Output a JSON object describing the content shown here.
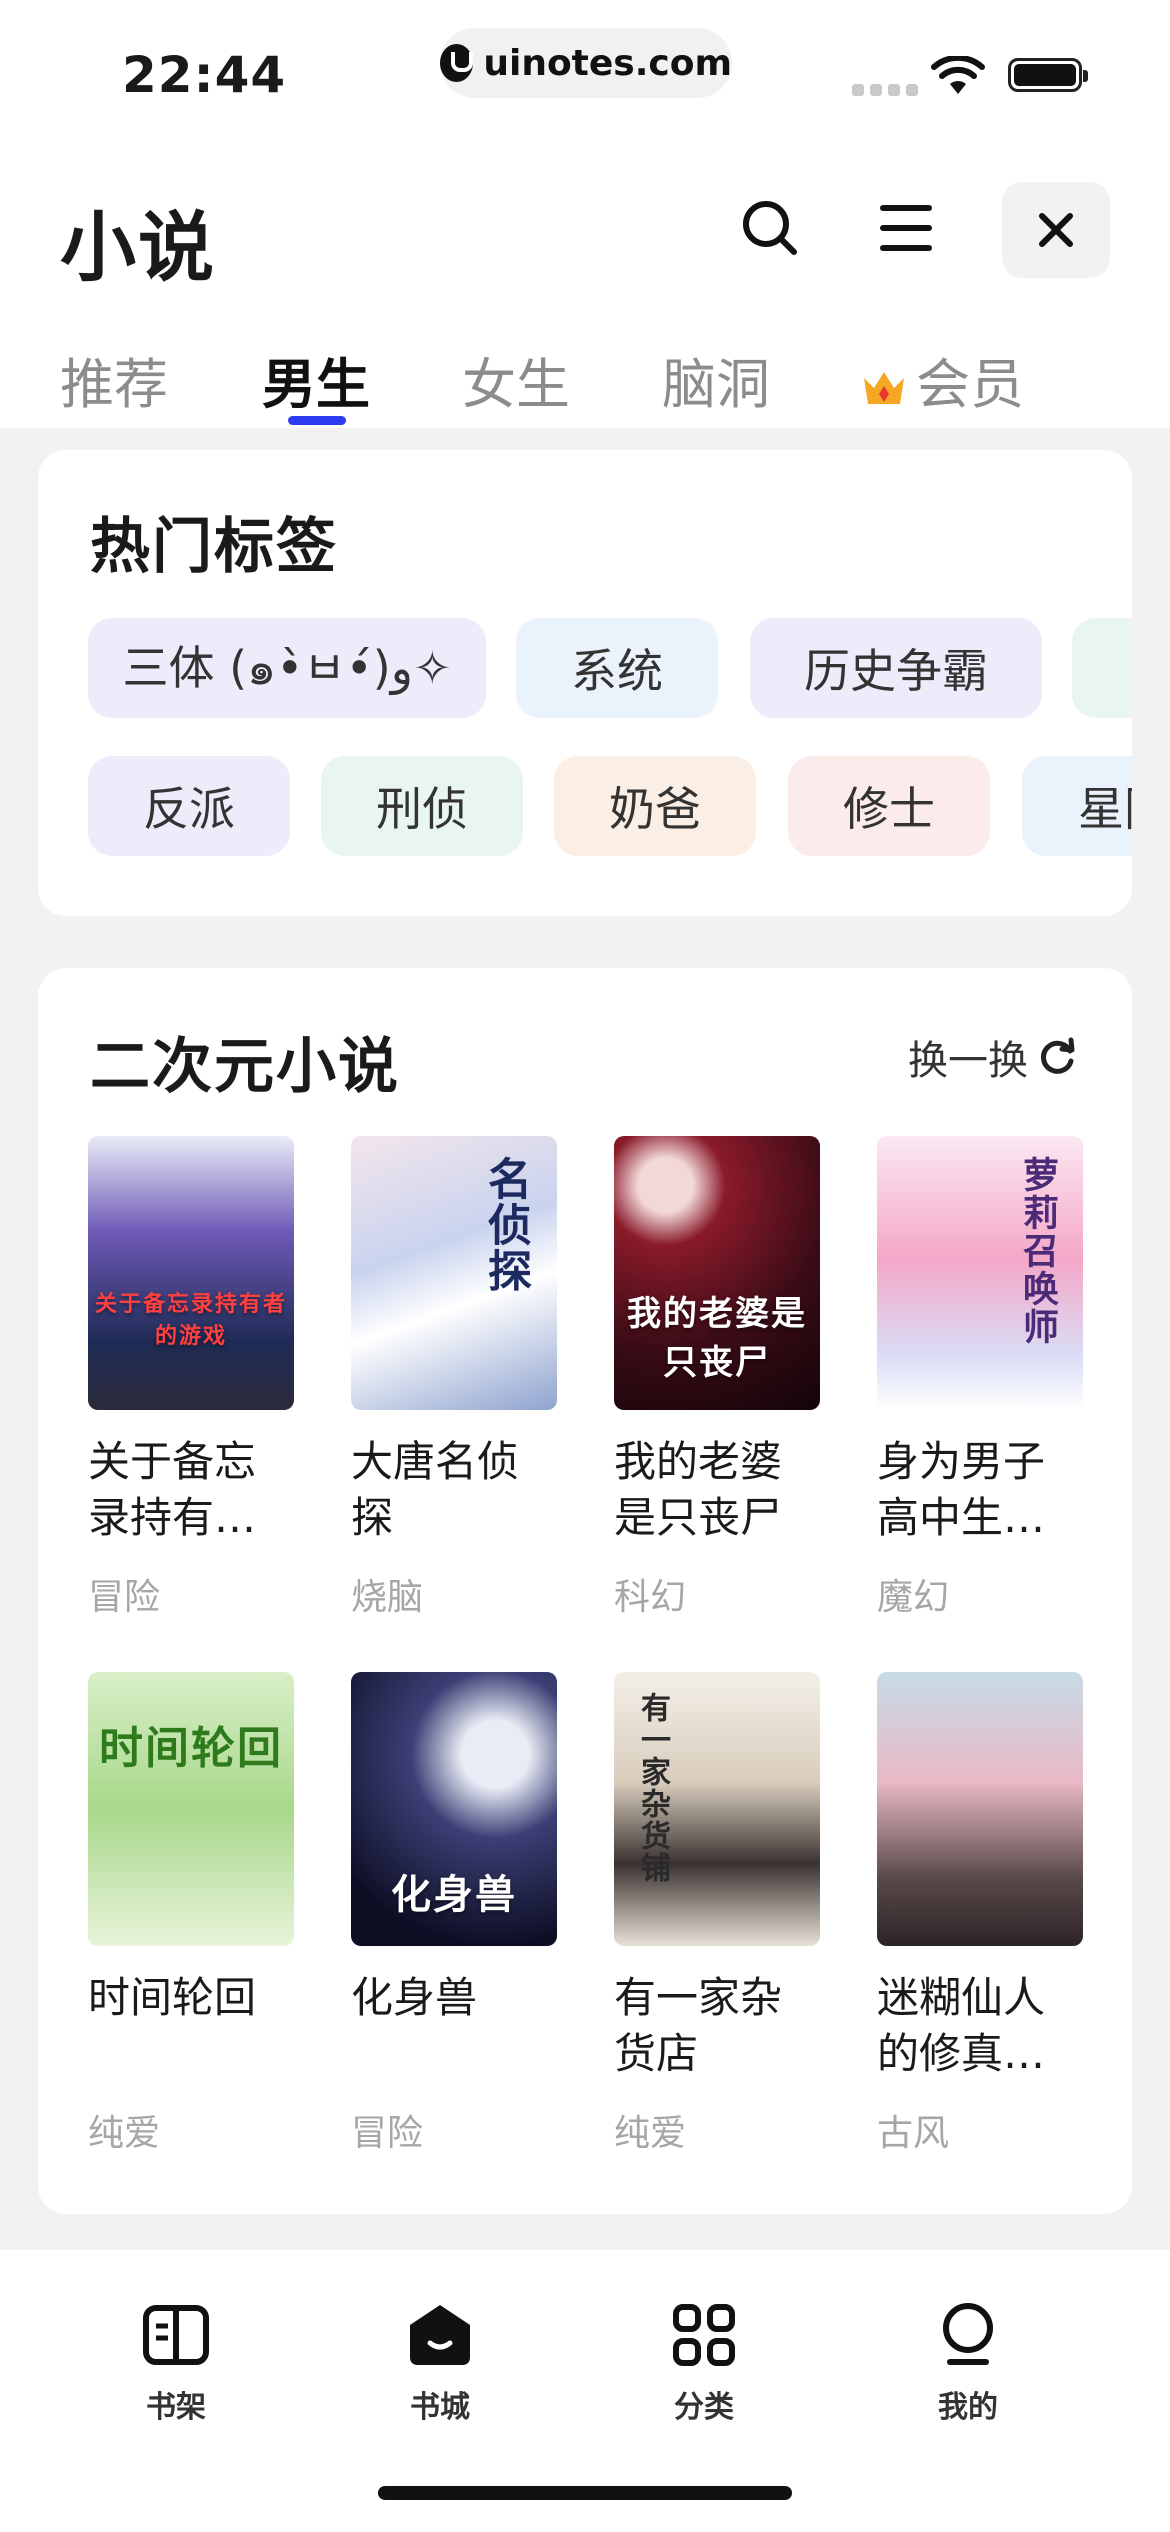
{
  "status": {
    "time": "22:44",
    "url": "uinotes.com"
  },
  "header": {
    "title": "小说"
  },
  "tabs": [
    {
      "label": "推荐"
    },
    {
      "label": "男生"
    },
    {
      "label": "女生"
    },
    {
      "label": "脑洞"
    },
    {
      "label": "会员"
    }
  ],
  "hot_tags": {
    "title": "热门标签",
    "row1": [
      "三体 (๑•̀ㅂ•́)و✧",
      "系统",
      "历史争霸",
      ""
    ],
    "row2": [
      "反派",
      "刑侦",
      "奶爸",
      "修士",
      "星际"
    ]
  },
  "section": {
    "title": "二次元小说",
    "refresh_label": "换一换",
    "books": [
      {
        "title": "关于备忘录持有…",
        "genre": "冒险",
        "cover_text": "关于备忘录持有者的游戏"
      },
      {
        "title": "大唐名侦探",
        "genre": "烧脑",
        "cover_text": "名侦探"
      },
      {
        "title": "我的老婆是只丧尸",
        "genre": "科幻",
        "cover_text": "我的老婆是只丧尸"
      },
      {
        "title": "身为男子高中生…",
        "genre": "魔幻",
        "cover_text": "萝莉召唤师"
      },
      {
        "title": "时间轮回",
        "genre": "纯爱",
        "cover_text": "时间轮回"
      },
      {
        "title": "化身兽",
        "genre": "冒险",
        "cover_text": "化身兽"
      },
      {
        "title": "有一家杂货店",
        "genre": "纯爱",
        "cover_text": "有一家杂货铺"
      },
      {
        "title": "迷糊仙人的修真…",
        "genre": "古风",
        "cover_text": ""
      }
    ]
  },
  "bottom_nav": [
    {
      "label": "书架",
      "icon": "bookshelf-icon"
    },
    {
      "label": "书城",
      "icon": "bookstore-icon"
    },
    {
      "label": "分类",
      "icon": "category-icon"
    },
    {
      "label": "我的",
      "icon": "profile-icon"
    }
  ],
  "colors": {
    "accent": "#2b3cf0",
    "page_bg": "#f2f2f4"
  }
}
